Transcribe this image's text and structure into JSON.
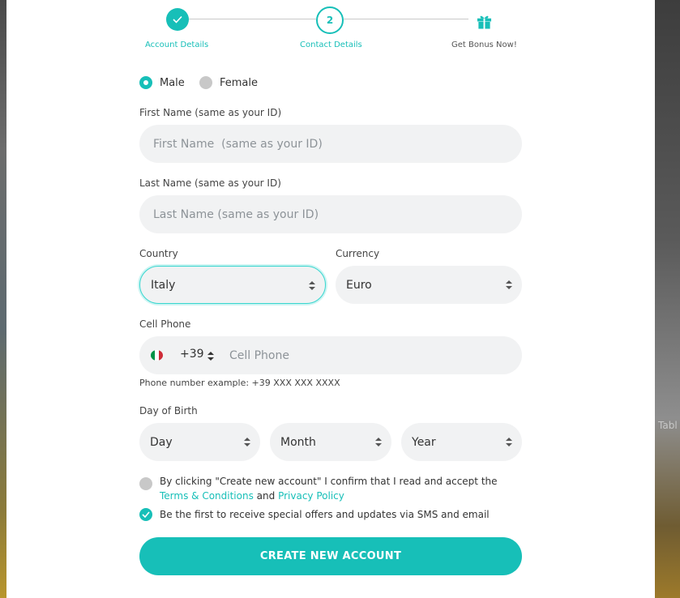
{
  "stepper": {
    "step1": {
      "label": "Account Details",
      "icon": "check-icon"
    },
    "step2": {
      "label": "Contact Details",
      "number": "2"
    },
    "step3": {
      "label": "Get Bonus Now!",
      "icon": "gift-icon"
    }
  },
  "gender": {
    "male_label": "Male",
    "female_label": "Female",
    "selected": "Male"
  },
  "first_name": {
    "label": "First Name (same as your ID)",
    "placeholder": "First Name  (same as your ID)",
    "value": ""
  },
  "last_name": {
    "label": "Last Name (same as your ID)",
    "placeholder": "Last Name (same as your ID)",
    "value": ""
  },
  "country": {
    "label": "Country",
    "value": "Italy"
  },
  "currency": {
    "label": "Currency",
    "value": "Euro"
  },
  "phone": {
    "label": "Cell Phone",
    "flag": "italy-flag-icon",
    "code": "+39",
    "placeholder": "Cell Phone",
    "hint": "Phone number example: +39 XXX XXX XXXX"
  },
  "birth": {
    "label": "Day of Birth",
    "day": "Day",
    "month": "Month",
    "year": "Year"
  },
  "terms": {
    "prefix": "By clicking \"Create new account\" I confirm that I read and accept the",
    "terms_link": "Terms & Conditions",
    "and": "and",
    "privacy_link": "Privacy Policy",
    "checked": false
  },
  "offers": {
    "text": "Be the first to receive special offers and updates via SMS and email",
    "checked": true
  },
  "submit_label": "CREATE NEW ACCOUNT",
  "colors": {
    "accent": "#17bfb8",
    "field_bg": "#f1f2f3"
  },
  "background_text": "Tabl"
}
